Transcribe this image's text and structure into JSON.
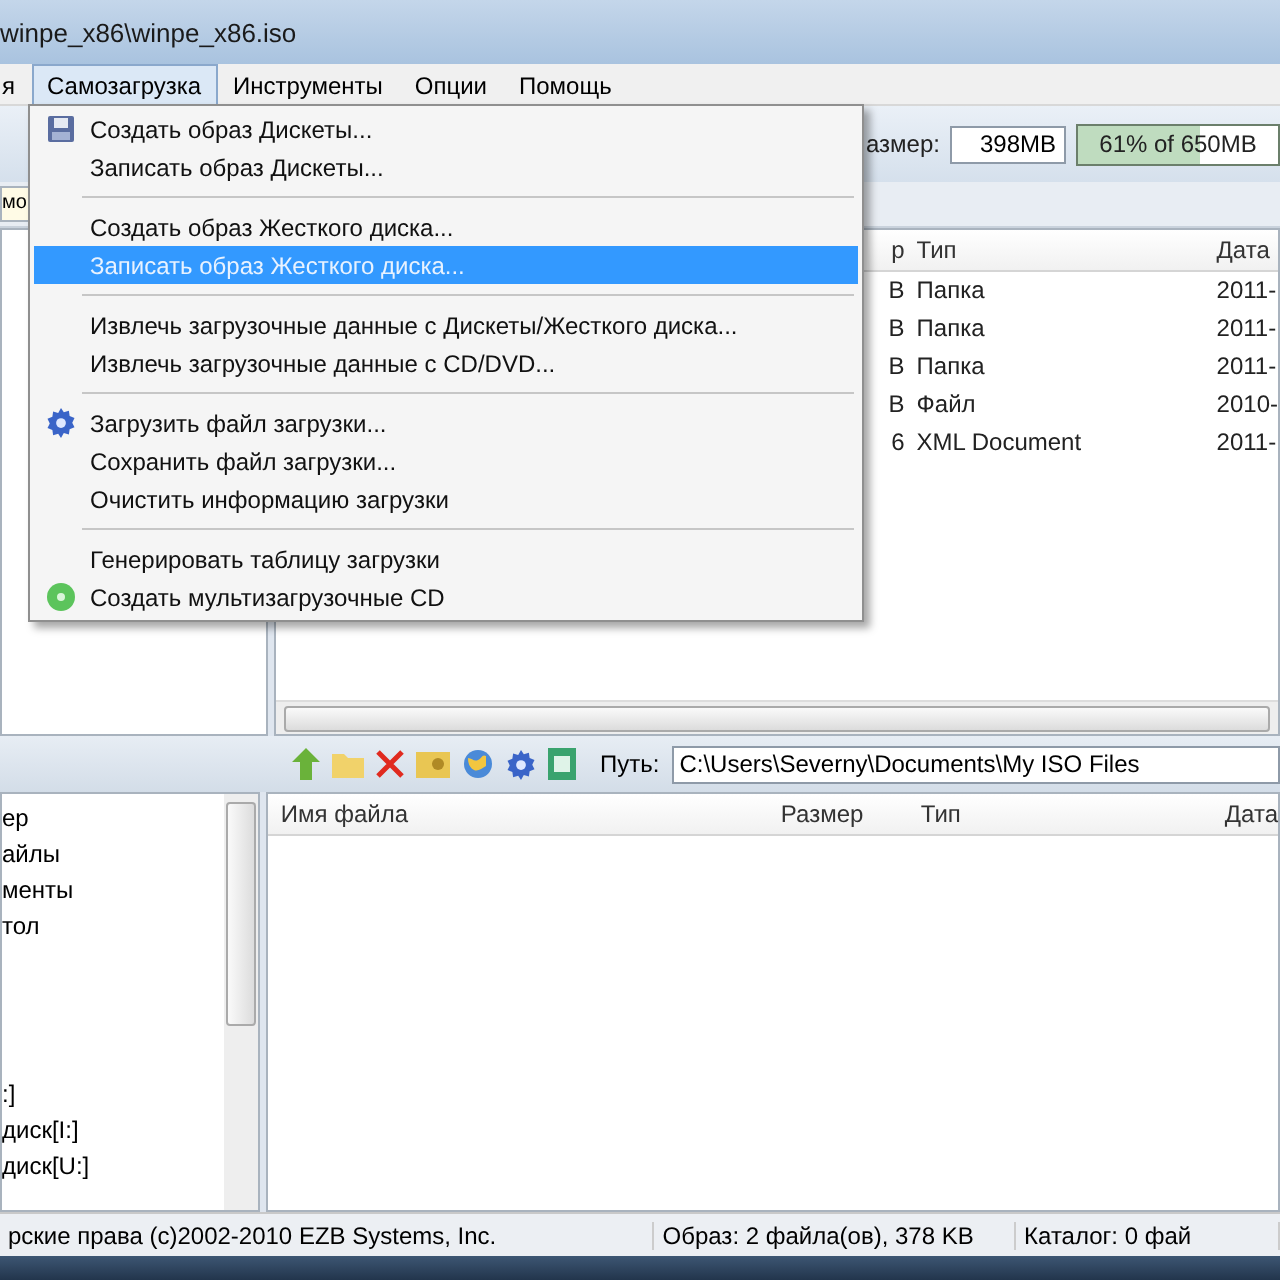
{
  "window": {
    "title": "winpe_x86\\winpe_x86.iso"
  },
  "menubar": [
    {
      "label": "я",
      "selected": false
    },
    {
      "label": "Самозагрузка",
      "selected": true
    },
    {
      "label": "Инструменты",
      "selected": false
    },
    {
      "label": "Опции",
      "selected": false
    },
    {
      "label": "Помощь",
      "selected": false
    }
  ],
  "menu": {
    "items": [
      {
        "kind": "item",
        "label": "Создать образ Дискеты...",
        "selected": false
      },
      {
        "kind": "item",
        "label": "Записать образ Дискеты...",
        "selected": false
      },
      {
        "kind": "separator"
      },
      {
        "kind": "item",
        "label": "Создать образ Жесткого диска...",
        "selected": false
      },
      {
        "kind": "item",
        "label": "Записать образ Жесткого диска...",
        "selected": true
      },
      {
        "kind": "separator"
      },
      {
        "kind": "item",
        "label": "Извлечь загрузочные данные с Дискеты/Жесткого диска...",
        "selected": false
      },
      {
        "kind": "item",
        "label": "Извлечь загрузочные данные с CD/DVD...",
        "selected": false
      },
      {
        "kind": "separator"
      },
      {
        "kind": "item",
        "label": "Загрузить файл загрузки...",
        "selected": false
      },
      {
        "kind": "item",
        "label": "Сохранить файл загрузки...",
        "selected": false
      },
      {
        "kind": "item",
        "label": "Очистить информацию загрузки",
        "selected": false
      },
      {
        "kind": "separator"
      },
      {
        "kind": "item",
        "label": "Генерировать таблицу загрузки",
        "selected": false
      },
      {
        "kind": "item",
        "label": "Создать мультизагрузочные CD",
        "selected": false
      }
    ]
  },
  "toolbar": {
    "size_label": "азмер:",
    "size_value": "398MB",
    "capacity": {
      "label": "61% of 650MB",
      "level": 0.61
    }
  },
  "address_field": "мо",
  "image_list": {
    "columns": [
      "р",
      "Тип",
      "Дата"
    ],
    "rows": [
      [
        "B",
        "Папка",
        "2011-"
      ],
      [
        "B",
        "Папка",
        "2011-"
      ],
      [
        "B",
        "Папка",
        "2011-"
      ],
      [
        "B",
        "Файл",
        "2010-"
      ],
      [
        "6",
        "XML Document",
        "2011-"
      ]
    ]
  },
  "path": {
    "label": "Путь:",
    "value": "C:\\Users\\Severny\\Documents\\My ISO Files"
  },
  "folder_tree": [
    "ер",
    "айлы",
    "менты",
    "тол",
    ":]",
    "диск[I:]",
    "диск[U:]"
  ],
  "local_list": {
    "columns": [
      "Имя файла",
      "Размер",
      "Тип",
      "Дата"
    ]
  },
  "status_bar": [
    "рские права (c)2002-2010 EZB Systems, Inc.",
    "Образ: 2 файла(ов), 378 KB",
    "Каталог: 0 фай"
  ]
}
